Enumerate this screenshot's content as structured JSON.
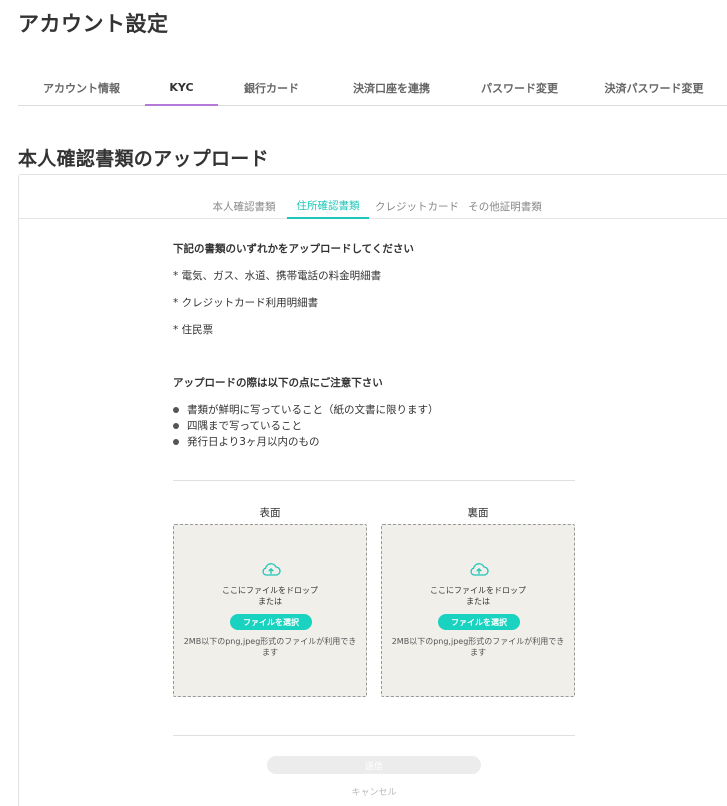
{
  "page": {
    "title": "アカウント設定"
  },
  "main_tabs": [
    {
      "label": "アカウント情報",
      "active": false
    },
    {
      "label": "KYC",
      "active": true
    },
    {
      "label": "銀行カード",
      "active": false
    },
    {
      "label": "決済口座を連携",
      "active": false
    },
    {
      "label": "パスワード変更",
      "active": false
    },
    {
      "label": "決済パスワード変更",
      "active": false
    }
  ],
  "section": {
    "title": "本人確認書類のアップロード"
  },
  "sub_tabs": [
    {
      "label": "本人確認書類",
      "active": false
    },
    {
      "label": "住所確認書類",
      "active": true
    },
    {
      "label": "クレジットカード",
      "active": false
    },
    {
      "label": "その他証明書類",
      "active": false
    }
  ],
  "instructions": {
    "heading": "下記の書類のいずれかをアップロードしてください",
    "documents": [
      "* 電気、ガス、水道、携帯電話の料金明細書",
      "* クレジットカード利用明細書",
      "* 住民票"
    ],
    "notes_heading": "アップロードの際は以下の点にご注意下さい",
    "notes": [
      "書類が鮮明に写っていること（紙の文書に限ります）",
      "四隅まで写っていること",
      "発行日より3ヶ月以内のもの"
    ]
  },
  "upload": {
    "front": {
      "label": "表面",
      "drop_text": "ここにファイルをドロップ",
      "or_text": "または",
      "button_label": "ファイルを選択",
      "note": "2MB以下のpng,jpeg形式のファイルが利用できます"
    },
    "back": {
      "label": "裏面",
      "drop_text": "ここにファイルをドロップ",
      "or_text": "または",
      "button_label": "ファイルを選択",
      "note": "2MB以下のpng,jpeg形式のファイルが利用できます"
    }
  },
  "actions": {
    "submit_label": "送信",
    "cancel_label": "キャンセル"
  },
  "colors": {
    "accent": "#1cc6b8",
    "tab_indicator": "#b57ad8",
    "dropzone_bg": "#f1efea"
  },
  "icons": {
    "upload": "cloud-upload-icon",
    "bullet": "bullet-dot-icon"
  }
}
